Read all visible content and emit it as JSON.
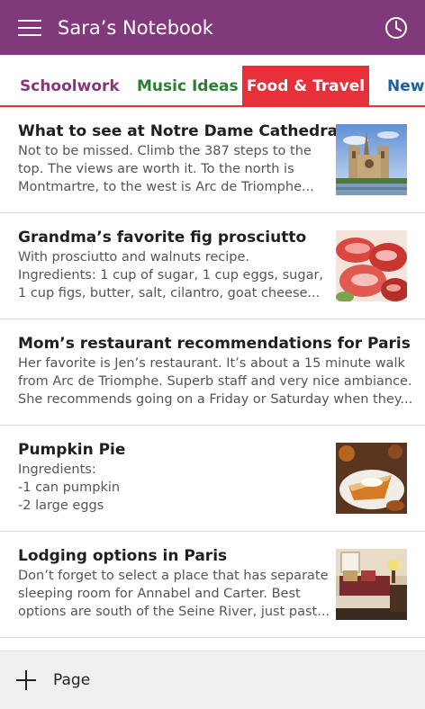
{
  "app_bar": {
    "title": "Sara’s Notebook",
    "menu_icon": "hamburger-menu-icon",
    "history_icon": "clock-icon",
    "color": "#80397b"
  },
  "tabs": [
    {
      "label": "Schoolwork",
      "color": "#86367a",
      "selected": false
    },
    {
      "label": "Music Ideas",
      "color": "#2e7d32",
      "selected": false
    },
    {
      "label": "Food & Travel",
      "color": "#e8303a",
      "selected": true
    },
    {
      "label": "New",
      "color": "#1f5f9c",
      "selected": false
    }
  ],
  "pages": [
    {
      "title": "What to see at Notre Dame Cathedral",
      "snippet": [
        "Not to be missed. Climb the 387 steps to the",
        "top. The views are worth it. To the north is",
        "Montmartre, to the west is Arc de Triomphe..."
      ],
      "thumbnail": "cathedral-photo"
    },
    {
      "title": "Grandma’s favorite fig prosciutto",
      "snippet": [
        "With prosciutto and walnuts recipe.",
        "Ingredients: 1 cup of sugar, 1 cup eggs, sugar,",
        "1 cup figs, butter, salt, cilantro, goat cheese..."
      ],
      "thumbnail": "prosciutto-photo"
    },
    {
      "title": "Mom’s restaurant recommendations for Paris",
      "snippet": [
        "Her favorite is Jen’s restaurant. It’s about a 15 minute walk",
        "from Arc de Triomphe. Superb staff and very nice ambiance.",
        "She recommends going on a Friday or Saturday when they..."
      ],
      "thumbnail": null
    },
    {
      "title": "Pumpkin Pie",
      "snippet": [
        "Ingredients:",
        "-1 can pumpkin",
        "-2 large eggs"
      ],
      "thumbnail": "pumpkin-pie-photo"
    },
    {
      "title": "Lodging options in Paris",
      "snippet": [
        "Don’t forget to select a place that has separate",
        "sleeping room for Annabel and Carter. Best",
        "options are south of the Seine River, just past..."
      ],
      "thumbnail": "bedroom-photo"
    }
  ],
  "bottom_bar": {
    "add_label": "Page",
    "add_icon": "plus-icon"
  }
}
